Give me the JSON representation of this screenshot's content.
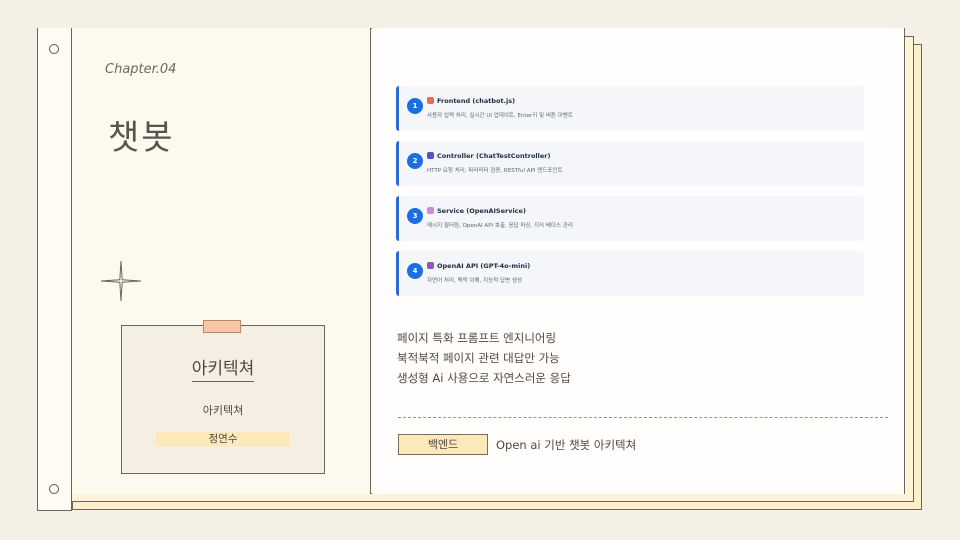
{
  "left": {
    "chapter": "Chapter.04",
    "title": "챗봇",
    "card": {
      "title": "아키텍쳐",
      "subtitle": "아키텍쳐",
      "name": "정연수"
    }
  },
  "layers": [
    {
      "number": "1",
      "title": "Frontend (chatbot.js)",
      "desc": "사용자 입력 처리, 실시간 UI 업데이트, Enter키 및 버튼 이벤트",
      "icon": "shield-icon",
      "icon_color": "#e86a5a"
    },
    {
      "number": "2",
      "title": "Controller (ChatTestController)",
      "desc": "HTTP 요청 처리, 파라미터 검증, RESTful API 엔드포인트",
      "icon": "bookmark-icon",
      "icon_color": "#5b4fc8"
    },
    {
      "number": "3",
      "title": "Service (OpenAIService)",
      "desc": "메시지 필터링, OpenAI API 호출, 응답 파싱, 지식 베이스 관리",
      "icon": "brain-icon",
      "icon_color": "#c98be0"
    },
    {
      "number": "4",
      "title": "OpenAI API (GPT-4o-mini)",
      "desc": "자연어 처리, 맥락 이해, 지능적 답변 생성",
      "icon": "robot-icon",
      "icon_color": "#8a5ab8"
    }
  ],
  "features": [
    "페이지 특화 프롬프트 엔지니어링",
    "북적북적 페이지 관련 대답만 가능",
    "생성형 Ai 사용으로 자연스러운 응답"
  ],
  "footer": {
    "badge": "백엔드",
    "text": "Open ai 기반 챗봇 아키텍쳐"
  },
  "colors": {
    "accent": "#1b6fe0",
    "paper": "#fdfbf4",
    "highlight": "#fbe9ba",
    "tape": "#f6c6a6"
  }
}
